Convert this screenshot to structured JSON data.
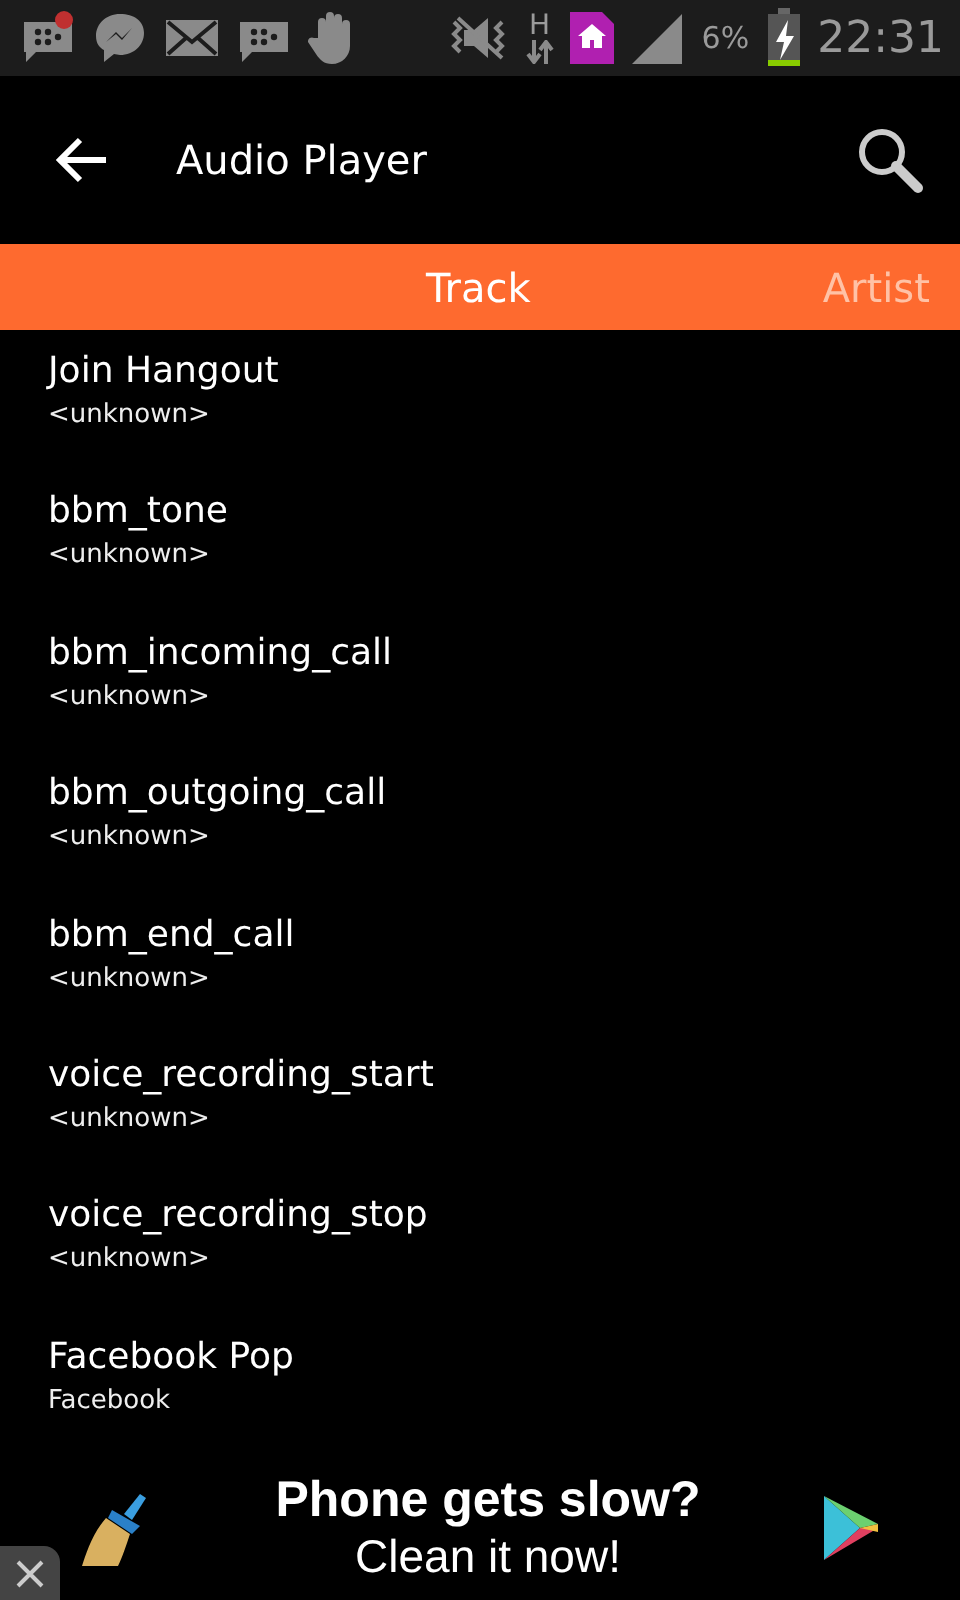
{
  "status_bar": {
    "network": "H",
    "battery": "6%",
    "time": "22:31"
  },
  "app_bar": {
    "title": "Audio Player"
  },
  "tabs": [
    {
      "label": "Track",
      "selected": true
    },
    {
      "label": "Artist",
      "selected": false
    }
  ],
  "tracks": [
    {
      "title": "Join Hangout",
      "artist": "<unknown>"
    },
    {
      "title": "bbm_tone",
      "artist": "<unknown>"
    },
    {
      "title": "bbm_incoming_call",
      "artist": "<unknown>"
    },
    {
      "title": "bbm_outgoing_call",
      "artist": "<unknown>"
    },
    {
      "title": "bbm_end_call",
      "artist": "<unknown>"
    },
    {
      "title": "voice_recording_start",
      "artist": "<unknown>"
    },
    {
      "title": "voice_recording_stop",
      "artist": "<unknown>"
    },
    {
      "title": "Facebook Pop",
      "artist": "Facebook"
    }
  ],
  "ad": {
    "headline": "Phone gets slow?",
    "subline": "Clean it now!"
  }
}
